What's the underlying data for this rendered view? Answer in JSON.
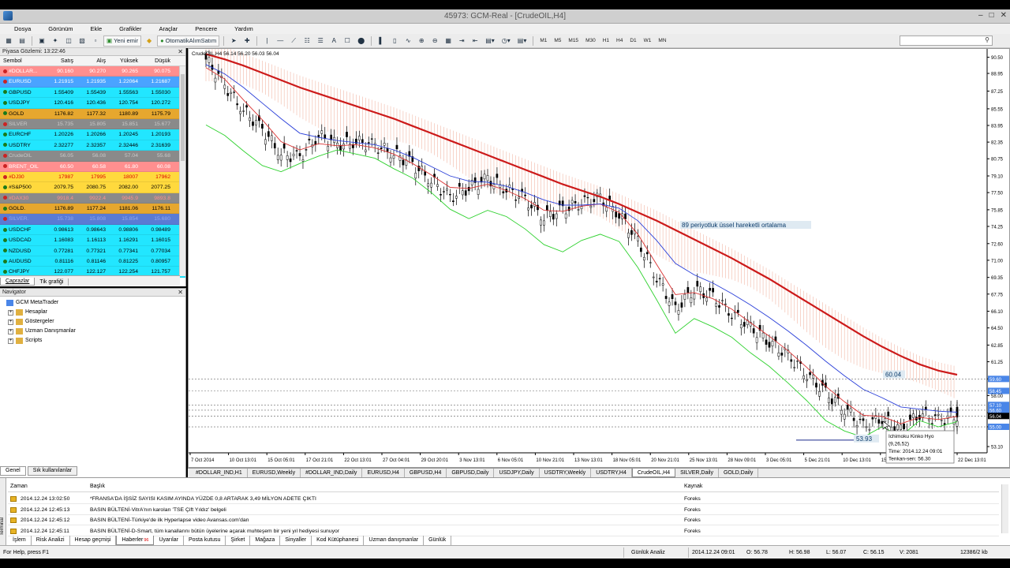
{
  "window": {
    "title": "45973: GCM-Real - [CrudeOIL,H4]"
  },
  "menu": [
    "Dosya",
    "Görünüm",
    "Ekle",
    "Grafikler",
    "Araçlar",
    "Pencere",
    "Yardım"
  ],
  "toolbar": {
    "new_order": "Yeni emir",
    "auto_trading": "OtomatikAlımSatım",
    "timeframes": [
      "M1",
      "M5",
      "M15",
      "M30",
      "H1",
      "H4",
      "D1",
      "W1",
      "MN"
    ]
  },
  "market_watch": {
    "title": "Piyasa Gözlemi: 13:22:46",
    "headers": [
      "Sembol",
      "Satış",
      "Alış",
      "Yüksek",
      "Düşük"
    ],
    "rows": [
      {
        "sym": "#DOLLAR...",
        "bid": "90.160",
        "ask": "90.270",
        "high": "90.265",
        "low": "90.075",
        "bg": "#ff8f8f",
        "fg": "#fff"
      },
      {
        "sym": "EURUSD",
        "bid": "1.21915",
        "ask": "1.21935",
        "high": "1.22064",
        "low": "1.21687",
        "bg": "#4aa3ff",
        "fg": "#fff"
      },
      {
        "sym": "GBPUSD",
        "bid": "1.55409",
        "ask": "1.55439",
        "high": "1.55563",
        "low": "1.55030",
        "bg": "#22e6ff",
        "fg": "#000"
      },
      {
        "sym": "USDJPY",
        "bid": "120.416",
        "ask": "120.436",
        "high": "120.754",
        "low": "120.272",
        "bg": "#22e6ff",
        "fg": "#000"
      },
      {
        "sym": "GOLD",
        "bid": "1176.82",
        "ask": "1177.32",
        "high": "1180.89",
        "low": "1175.79",
        "bg": "#e6a72e",
        "fg": "#000"
      },
      {
        "sym": "SILVER",
        "bid": "15.735",
        "ask": "15.805",
        "high": "15.851",
        "low": "15.677",
        "bg": "#8a8a8a",
        "fg": "#c9c9c9"
      },
      {
        "sym": "EURCHF",
        "bid": "1.20226",
        "ask": "1.20266",
        "high": "1.20245",
        "low": "1.20193",
        "bg": "#22e6ff",
        "fg": "#000"
      },
      {
        "sym": "USDTRY",
        "bid": "2.32277",
        "ask": "2.32357",
        "high": "2.32446",
        "low": "2.31639",
        "bg": "#22e6ff",
        "fg": "#000"
      },
      {
        "sym": "CrudeOIL",
        "bid": "56.05",
        "ask": "56.08",
        "high": "57.04",
        "low": "55.68",
        "bg": "#8a8a8a",
        "fg": "#c9c9c9"
      },
      {
        "sym": "BRENT_OIL",
        "bid": "60.50",
        "ask": "60.58",
        "high": "61.80",
        "low": "60.08",
        "bg": "#ff8f8f",
        "fg": "#fff"
      },
      {
        "sym": "#DJ30",
        "bid": "17987",
        "ask": "17995",
        "high": "18007",
        "low": "17962",
        "bg": "#ffd93d",
        "fg": "#d00"
      },
      {
        "sym": "#S&P500",
        "bid": "2079.75",
        "ask": "2080.75",
        "high": "2082.00",
        "low": "2077.25",
        "bg": "#ffd93d",
        "fg": "#000"
      },
      {
        "sym": "#DAX30",
        "bid": "9918.4",
        "ask": "9922.4",
        "high": "9945.9",
        "low": "9893.8",
        "bg": "#8a8a8a",
        "fg": "#ff8f8f"
      },
      {
        "sym": "GOLD.",
        "bid": "1176.89",
        "ask": "1177.24",
        "high": "1181.06",
        "low": "1176.11",
        "bg": "#e6a72e",
        "fg": "#000"
      },
      {
        "sym": "SILVER.",
        "bid": "15.738",
        "ask": "15.808",
        "high": "15.854",
        "low": "15.680",
        "bg": "#5a7bd4",
        "fg": "#8fa6ee"
      },
      {
        "sym": "USDCHF",
        "bid": "0.98613",
        "ask": "0.98643",
        "high": "0.98806",
        "low": "0.98489",
        "bg": "#22e6ff",
        "fg": "#000"
      },
      {
        "sym": "USDCAD",
        "bid": "1.16083",
        "ask": "1.16113",
        "high": "1.16291",
        "low": "1.16015",
        "bg": "#22e6ff",
        "fg": "#000"
      },
      {
        "sym": "NZDUSD",
        "bid": "0.77281",
        "ask": "0.77321",
        "high": "0.77341",
        "low": "0.77034",
        "bg": "#22e6ff",
        "fg": "#000"
      },
      {
        "sym": "AUDUSD",
        "bid": "0.81116",
        "ask": "0.81146",
        "high": "0.81225",
        "low": "0.80957",
        "bg": "#22e6ff",
        "fg": "#000"
      },
      {
        "sym": "CHFJPY",
        "bid": "122.077",
        "ask": "122.127",
        "high": "122.254",
        "low": "121.757",
        "bg": "#22e6ff",
        "fg": "#000"
      }
    ],
    "tabs": [
      "Çaprazlar",
      "Tik grafiği"
    ]
  },
  "navigator": {
    "title": "Navigator",
    "root": "GCM MetaTrader",
    "items": [
      "Hesaplar",
      "Göstergeler",
      "Uzman Danışmanlar",
      "Scripts"
    ],
    "tabs": [
      "Genel",
      "Sık kullanılanlar"
    ]
  },
  "chart": {
    "info": "CrudeOIL,H4  56.14 56.20 56.03 56.04",
    "annotation": "89 periyotluk üssel hareketli ortalama",
    "ma_label": "60.04",
    "low_label": "53.93",
    "tooltip": [
      "Ichimoku Kinko Hyo",
      "(9,26,52)",
      "Time: 2014.12.24 09:01",
      "Tenkan-sen: 56.30"
    ]
  },
  "chart_data": {
    "type": "line",
    "title": "",
    "xlabel": "",
    "ylabel": "",
    "x_ticks": [
      "7 Oct 2014",
      "10 Oct 13:01",
      "15 Oct 05:01",
      "17 Oct 21:01",
      "22 Oct 13:01",
      "27 Oct 04:01",
      "29 Oct 20:01",
      "3 Nov 13:01",
      "6 Nov 05:01",
      "10 Nov 21:01",
      "13 Nov 13:01",
      "18 Nov 05:01",
      "20 Nov 21:01",
      "25 Nov 13:01",
      "28 Nov 09:01",
      "3 Dec 05:01",
      "5 Dec 21:01",
      "10 Dec 13:01",
      "15 Dec 05:01",
      "17 Dec 21:01",
      "22 Dec 13:01"
    ],
    "y_ticks": [
      "90.50",
      "88.95",
      "87.25",
      "85.55",
      "83.95",
      "82.35",
      "80.75",
      "79.10",
      "77.50",
      "75.85",
      "74.25",
      "72.60",
      "71.00",
      "69.35",
      "67.75",
      "66.10",
      "64.50",
      "62.85",
      "61.25",
      "59.60",
      "58.00",
      "56.35",
      "55.00",
      "53.10"
    ],
    "ylim": [
      52.5,
      91.0
    ],
    "price_tags": [
      {
        "value": 59.6,
        "label": "59.60",
        "color": "#4a86e8"
      },
      {
        "value": 58.45,
        "label": "58.45",
        "color": "#4a86e8"
      },
      {
        "value": 57.1,
        "label": "57.10",
        "color": "#4a86e8"
      },
      {
        "value": 56.6,
        "label": "56.60",
        "color": "#4a86e8"
      },
      {
        "value": 56.04,
        "label": "56.04",
        "color": "#000000"
      },
      {
        "value": 55.0,
        "label": "55.00",
        "color": "#4a86e8"
      }
    ],
    "series": [
      {
        "name": "",
        "color": "#000000",
        "values": [
          90.3,
          87.8,
          85.4,
          83.6,
          81.2,
          80.9,
          83.0,
          82.1,
          82.4,
          82.0,
          81.3,
          80.2,
          78.7,
          77.0,
          78.0,
          78.8,
          77.9,
          76.8,
          75.2,
          75.8,
          76.6,
          76.9,
          75.5,
          72.8,
          69.4,
          66.2,
          68.3,
          67.4,
          66.0,
          64.5,
          63.2,
          61.8,
          60.1,
          58.2,
          56.8,
          55.0,
          55.9,
          54.6,
          56.3,
          55.6,
          56.1
        ]
      },
      {
        "name": "",
        "color": "#d93030",
        "values": [
          89.5,
          88.4,
          86.4,
          84.5,
          82.4,
          81.6,
          82.2,
          82.0,
          82.1,
          81.8,
          81.2,
          80.3,
          79.2,
          78.0,
          77.9,
          78.3,
          77.7,
          76.9,
          75.8,
          75.7,
          76.2,
          76.4,
          75.6,
          73.5,
          70.6,
          67.7,
          67.9,
          67.3,
          66.3,
          65.0,
          63.7,
          62.3,
          60.7,
          58.9,
          57.4,
          56.1,
          56.0,
          55.3,
          55.9,
          55.7,
          56.0
        ]
      },
      {
        "name": "",
        "color": "#2a3fd9",
        "values": [
          89.8,
          88.9,
          87.6,
          86.1,
          84.6,
          83.2,
          82.8,
          82.5,
          82.3,
          82.1,
          81.6,
          80.9,
          80.0,
          79.1,
          78.6,
          78.5,
          78.1,
          77.5,
          76.8,
          76.3,
          76.3,
          76.4,
          76.0,
          74.8,
          72.9,
          70.7,
          69.6,
          68.8,
          67.8,
          66.7,
          65.5,
          64.2,
          62.8,
          61.3,
          59.9,
          58.6,
          57.8,
          56.9,
          56.7,
          56.5,
          56.4
        ]
      },
      {
        "name": "",
        "color": "#cc1a1a",
        "values": [
          90.8,
          90.3,
          89.7,
          89.0,
          88.3,
          87.6,
          87.0,
          86.4,
          85.8,
          85.2,
          84.6,
          83.9,
          83.2,
          82.5,
          81.8,
          81.1,
          80.4,
          79.7,
          79.0,
          78.3,
          77.7,
          77.1,
          76.4,
          75.6,
          74.8,
          73.9,
          73.0,
          72.1,
          71.2,
          70.2,
          69.2,
          68.1,
          67.0,
          65.9,
          64.8,
          63.7,
          62.7,
          61.8,
          61.0,
          60.4,
          60.0
        ]
      },
      {
        "name": "",
        "color": "#2ed12e",
        "values": [
          84.0,
          83.0,
          81.5,
          80.1,
          79.5,
          80.3,
          81.0,
          81.6,
          81.2,
          80.8,
          79.8,
          78.9,
          77.5,
          75.9,
          75.0,
          75.8,
          75.2,
          74.0,
          72.5,
          71.8,
          72.9,
          73.5,
          72.8,
          70.3,
          67.2,
          64.0,
          65.4,
          64.6,
          63.6,
          62.1,
          60.8,
          59.2,
          57.5,
          55.6,
          54.6,
          54.0,
          55.0,
          54.1,
          55.6,
          55.0,
          55.5
        ]
      }
    ]
  },
  "chart_tabs": [
    "#DOLLAR_IND,H1",
    "EURUSD,Weekly",
    "#DOLLAR_IND,Daily",
    "EURUSD,H4",
    "GBPUSD,H4",
    "GBPUSD,Daily",
    "USDJPY,Daily",
    "USDTRY,Weekly",
    "USDTRY,H4",
    "CrudeOIL,H4",
    "SILVER,Daily",
    "GOLD,Daily"
  ],
  "terminal": {
    "side": "Terminal",
    "headers": [
      "Zaman",
      "Başlık",
      "Kaynak"
    ],
    "rows": [
      {
        "time": "2014.12.24 13:02:50",
        "title": "*FRANSA'DA İŞSİZ SAYISI KASIM AYINDA YÜZDE 0,8 ARTARAK 3,49 MİLYON ADETE ÇIKTI",
        "src": "Foreks"
      },
      {
        "time": "2014.12.24 12:45:13",
        "title": "BASIN BÜLTENİ-VitrA'nın karoları 'TSE Çift Yıldız' belgeli",
        "src": "Foreks"
      },
      {
        "time": "2014.12.24 12:45:12",
        "title": "BASIN BÜLTENİ-Türkiye'de ilk Hyperlapse video Avansas.com'dan",
        "src": "Foreks"
      },
      {
        "time": "2014.12.24 12:45:11",
        "title": "BASIN BÜLTENİ-D-Smart, tüm kanallarını bütün üyelerine açarak muhteşem bir yeni yıl hediyesi sunuyor",
        "src": "Foreks"
      }
    ],
    "tabs": [
      "İşlem",
      "Risk Analizi",
      "Hesap geçmişi",
      "Haberler",
      "Uyarılar",
      "Posta kutusu",
      "Şirket",
      "Mağaza",
      "Sinyaller",
      "Kod Kütüphanesi",
      "Uzman danışmanlar",
      "Günlük"
    ],
    "news_badge": "96"
  },
  "status": {
    "help": "For Help, press F1",
    "profile": "Günlük Analiz",
    "time": "2014.12.24 09:01",
    "open": "O: 56.78",
    "high": "H: 56.98",
    "low": "L: 56.07",
    "close": "C: 56.15",
    "volume": "V: 2081",
    "traffic": "12386/2 kb"
  }
}
